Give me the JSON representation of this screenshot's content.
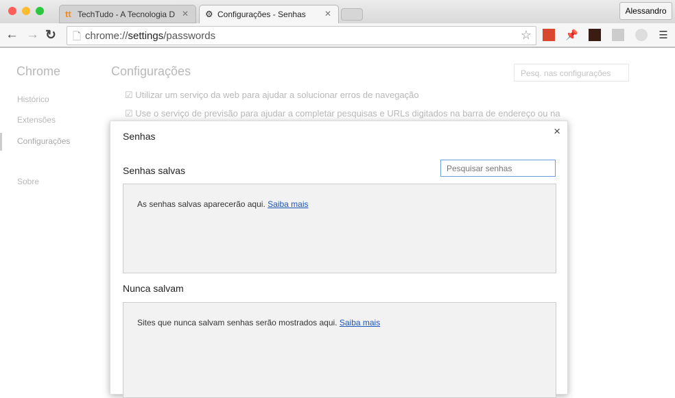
{
  "tabs": [
    {
      "label": "TechTudo - A Tecnologia D",
      "icon": "techtudo-icon"
    },
    {
      "label": "Configurações - Senhas",
      "icon": "gear-icon"
    }
  ],
  "profile": "Alessandro",
  "url": {
    "prefix": "chrome://",
    "bold": "settings",
    "suffix": "/passwords"
  },
  "sidebar": {
    "title": "Chrome",
    "items": [
      "Histórico",
      "Extensões",
      "Configurações",
      "Sobre"
    ]
  },
  "settings": {
    "title": "Configurações",
    "search_placeholder": "Pesq. nas configurações",
    "options": [
      "Utilizar um serviço da web para ajudar a solucionar erros de navegação",
      "Use o serviço de previsão para ajudar a completar pesquisas e URLs digitados na barra de endereço ou na"
    ]
  },
  "dialog": {
    "title": "Senhas",
    "close": "×",
    "saved_title": "Senhas salvas",
    "search_placeholder": "Pesquisar senhas",
    "saved_empty": "As senhas salvas aparecerão aqui.",
    "never_title": "Nunca salvam",
    "never_empty": "Sites que nunca salvam senhas serão mostrados aqui.",
    "learn_more": "Saiba mais"
  }
}
